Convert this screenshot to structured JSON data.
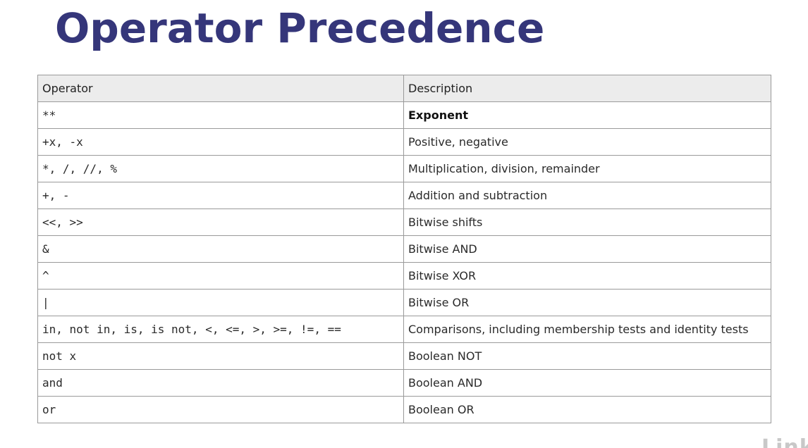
{
  "slide": {
    "title": "Operator Precedence"
  },
  "table": {
    "headers": {
      "operator": "Operator",
      "description": "Description"
    },
    "rows": [
      {
        "operator": "**",
        "description": "Exponent"
      },
      {
        "operator": "+x, -x",
        "description": "Positive, negative"
      },
      {
        "operator": "*, /, //, %",
        "description": "Multiplication, division, remainder"
      },
      {
        "operator": "+, -",
        "description": "Addition and subtraction"
      },
      {
        "operator": "<<, >>",
        "description": "Bitwise shifts"
      },
      {
        "operator": "&",
        "description": "Bitwise AND"
      },
      {
        "operator": "^",
        "description": "Bitwise XOR"
      },
      {
        "operator": "|",
        "description": "Bitwise OR"
      },
      {
        "operator": "in, not in, is, is not, <, <=, >, >=, !=, ==",
        "description": "Comparisons, including membership tests and identity tests"
      },
      {
        "operator": "not x",
        "description": "Boolean NOT"
      },
      {
        "operator": "and",
        "description": "Boolean AND"
      },
      {
        "operator": "or",
        "description": "Boolean OR"
      }
    ]
  },
  "watermark": {
    "text": "Linkedin"
  },
  "colors": {
    "title": "#35367a",
    "header_bg": "#ececec",
    "border": "#9a9a9a"
  }
}
